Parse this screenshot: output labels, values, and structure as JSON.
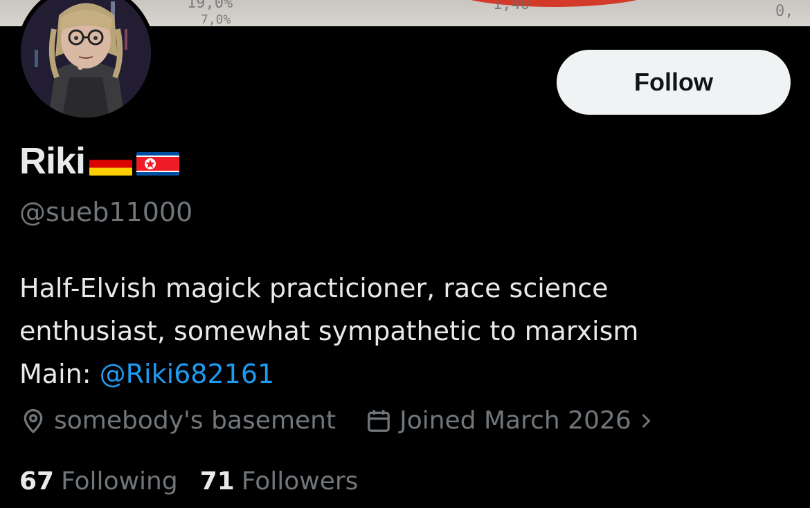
{
  "banner": {
    "scribbles": [
      "19,0%",
      "7,0%",
      "1,40",
      "0,"
    ]
  },
  "profile": {
    "name": "Riki",
    "flags": [
      "germany-flag",
      "north-korea-flag"
    ],
    "handle": "@sueb11000",
    "follow_label": "Follow",
    "bio_line1": "Half-Elvish magick practicioner, race science",
    "bio_line2": "enthusiast, somewhat sympathetic to marxism",
    "bio_main_prefix": "Main: ",
    "bio_main_mention": "@Riki682161",
    "location": "somebody's basement",
    "joined": "Joined March 2026",
    "following_count": "67",
    "following_label": "Following",
    "followers_count": "71",
    "followers_label": "Followers"
  },
  "colors": {
    "background": "#000000",
    "text": "#e7e9ea",
    "muted": "#71767b",
    "link": "#1d9bf0",
    "button_bg": "#eff3f4"
  },
  "icons": {
    "location": "location-pin-icon",
    "calendar": "calendar-icon",
    "chevron": "chevron-right-icon"
  }
}
